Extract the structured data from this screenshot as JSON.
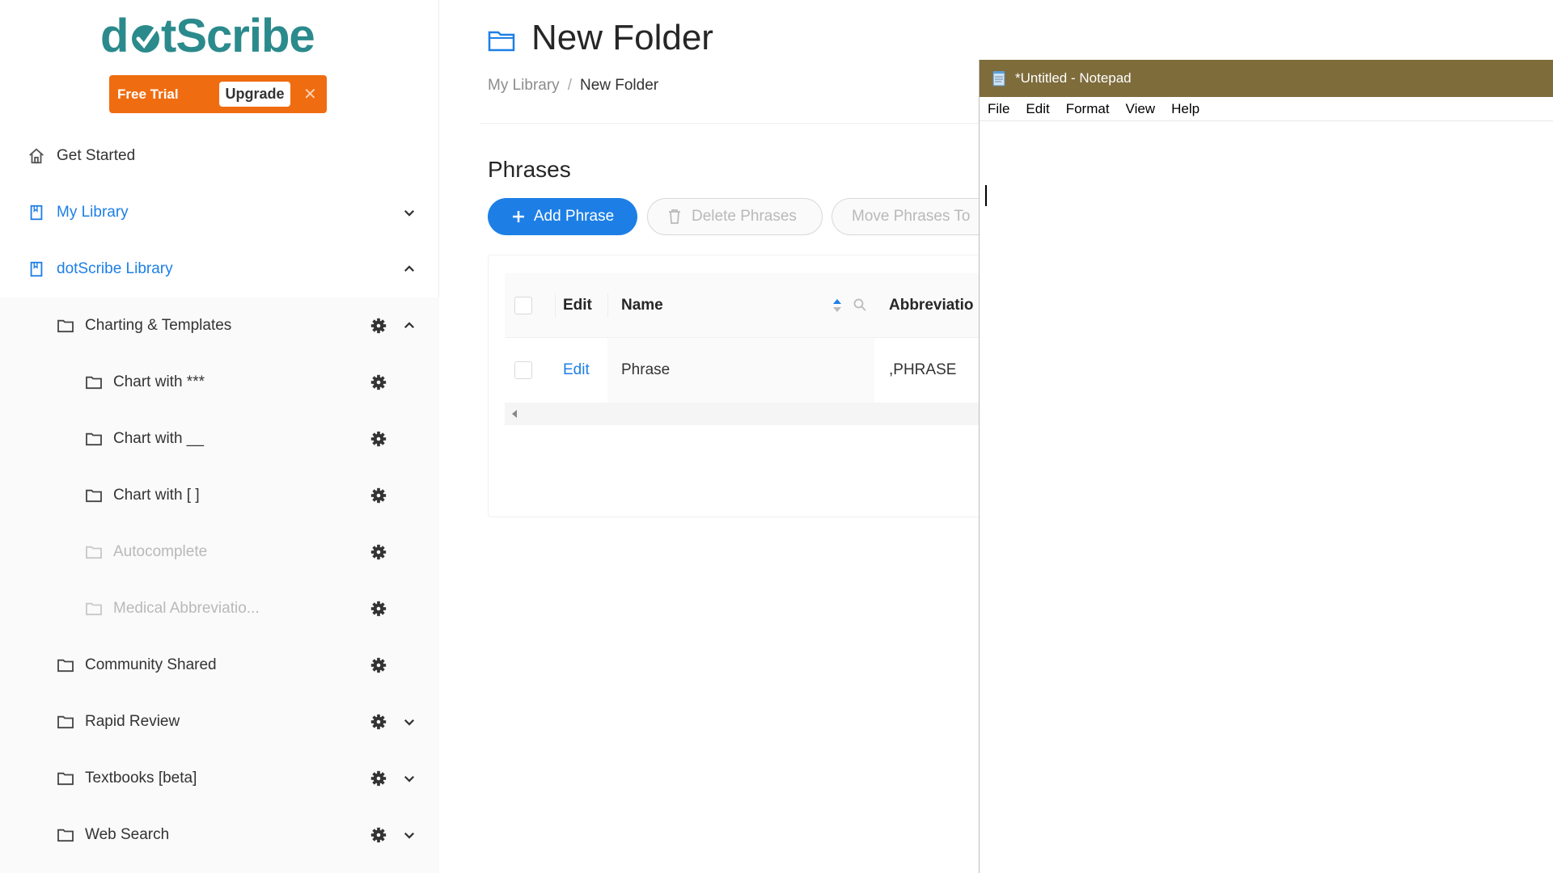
{
  "sidebar": {
    "logo": "dotScribe",
    "trial": {
      "label": "Free Trial",
      "upgrade": "Upgrade",
      "close": "✕"
    },
    "nav": [
      {
        "label": "Get Started"
      },
      {
        "label": "My Library"
      },
      {
        "label": "dotScribe Library"
      }
    ],
    "folders": [
      {
        "label": "Charting & Templates"
      },
      {
        "label": "Chart with ***"
      },
      {
        "label": "Chart with __"
      },
      {
        "label": "Chart with [ ]"
      },
      {
        "label": "Autocomplete"
      },
      {
        "label": "Medical Abbreviatio..."
      },
      {
        "label": "Community Shared"
      },
      {
        "label": "Rapid Review"
      },
      {
        "label": "Textbooks [beta]"
      },
      {
        "label": "Web Search"
      }
    ]
  },
  "main": {
    "title": "New Folder",
    "breadcrumb": {
      "root": "My Library",
      "separator": "/",
      "current": "New Folder"
    },
    "section_title": "Phrases",
    "buttons": {
      "add": "Add Phrase",
      "delete": "Delete Phrases",
      "move": "Move Phrases To"
    },
    "table": {
      "headers": {
        "edit": "Edit",
        "name": "Name",
        "abbreviation": "Abbreviatio"
      },
      "rows": [
        {
          "edit": "Edit",
          "name": "Phrase",
          "abbreviation": ",PHRASE"
        }
      ]
    }
  },
  "notepad": {
    "title": "*Untitled - Notepad",
    "menu": [
      "File",
      "Edit",
      "Format",
      "View",
      "Help"
    ]
  },
  "colors": {
    "accent": "#1d7fe6",
    "brand": "#2b8a8c",
    "trial": "#f06c10",
    "notepad_titlebar": "#7e6c3b"
  }
}
